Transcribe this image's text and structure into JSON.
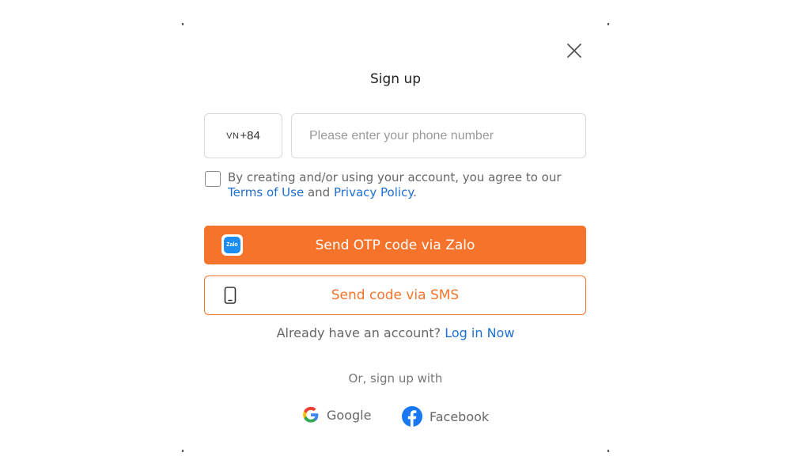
{
  "modal": {
    "title": "Sign up"
  },
  "phone": {
    "country_code": "VN",
    "dial_code": "+84",
    "placeholder": "Please enter your phone number",
    "value": ""
  },
  "agreement": {
    "checked": false,
    "text_before": "By creating and/or using your account, you agree to our",
    "terms_label": "Terms of Use",
    "middle": " and ",
    "privacy_label": "Privacy Policy",
    "end": "."
  },
  "buttons": {
    "zalo_label": "Send OTP code via Zalo",
    "zalo_icon_text": "Zalo",
    "sms_label": "Send code via SMS"
  },
  "login": {
    "prompt": "Already have an account?",
    "link_label": "Log in Now"
  },
  "social": {
    "heading": "Or, sign up with",
    "google_label": "Google",
    "facebook_label": "Facebook"
  },
  "colors": {
    "accent": "#f5732a",
    "link": "#1f6fd1",
    "zalo_blue": "#1d8ef0",
    "facebook_blue": "#1877f2"
  }
}
